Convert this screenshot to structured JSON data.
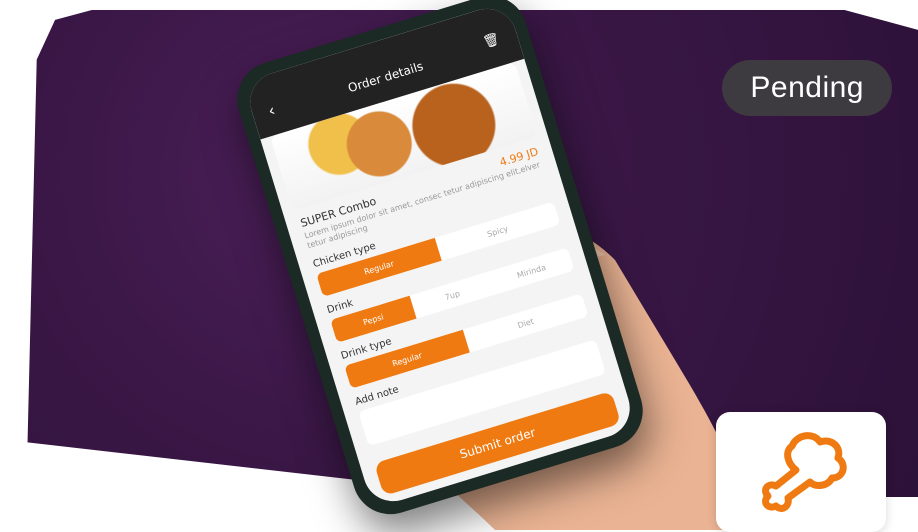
{
  "badge": {
    "status": "Pending"
  },
  "phone": {
    "header_title": "Order details",
    "product_name": "SUPER Combo",
    "price": "4.99 JD",
    "description": "Lorem ipsum dolor sit amet, consec tetur adipiscing elit,elver tetur adipiscing",
    "chicken_type": {
      "label": "Chicken type",
      "options": [
        "Regular",
        "Spicy"
      ],
      "selected": "Regular"
    },
    "drink": {
      "label": "Drink",
      "options": [
        "Pepsi",
        "7up",
        "Mirinda"
      ],
      "selected": "Pepsi"
    },
    "drink_type": {
      "label": "Drink type",
      "options": [
        "Regular",
        "Diet"
      ],
      "selected": "Regular"
    },
    "note_label": "Add note",
    "submit_label": "Submit order"
  },
  "colors": {
    "accent": "#f07a12",
    "background": "#3a1746",
    "badge": "#3d3a40"
  }
}
